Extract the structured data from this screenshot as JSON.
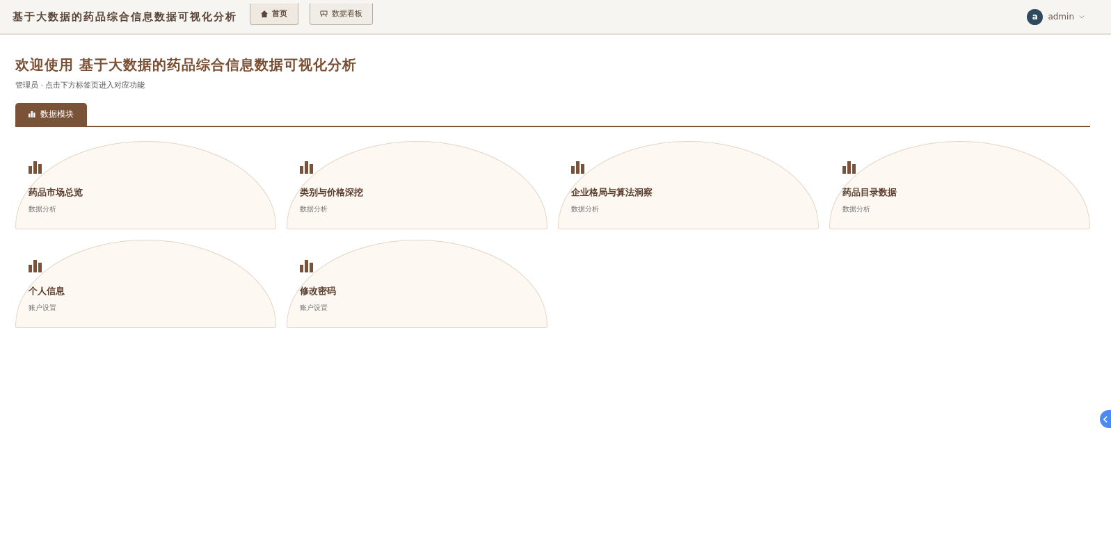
{
  "header": {
    "title": "基于大数据的药品综合信息数据可视化分析",
    "nav": [
      {
        "label": "首页",
        "kind": "home",
        "selected": true
      },
      {
        "label": "数据看板",
        "kind": "board",
        "selected": false
      }
    ],
    "user": {
      "avatar": "a",
      "name": "admin"
    }
  },
  "welcome": {
    "title": "欢迎使用 基于大数据的药品综合信息数据可视化分析",
    "subtitle": "管理员 · 点击下方标签页进入对应功能"
  },
  "tabs": [
    {
      "label": "数据模块",
      "selected": true
    }
  ],
  "cards": [
    {
      "title": "药品市场总览",
      "subtitle": "数据分析"
    },
    {
      "title": "类别与价格深挖",
      "subtitle": "数据分析"
    },
    {
      "title": "企业格局与算法洞察",
      "subtitle": "数据分析"
    },
    {
      "title": "药品目录数据",
      "subtitle": "数据分析"
    },
    {
      "title": "个人信息",
      "subtitle": "账户设置"
    },
    {
      "title": "修改密码",
      "subtitle": "账户设置"
    }
  ]
}
